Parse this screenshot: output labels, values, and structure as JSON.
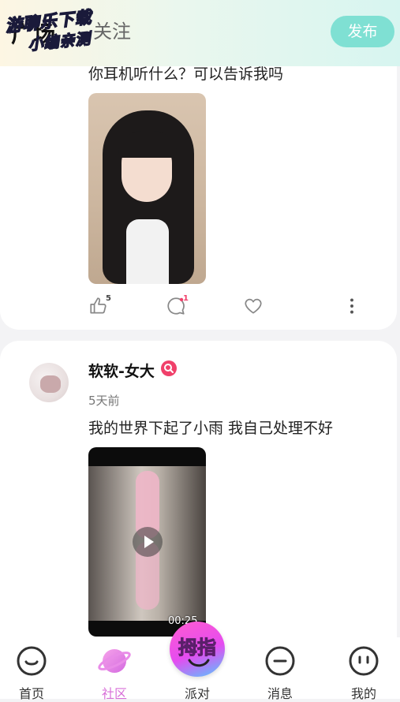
{
  "header": {
    "tabs": [
      "广场",
      "关注"
    ],
    "promo": [
      "游聊乐下载",
      "小编亲测"
    ],
    "publish_label": "发布"
  },
  "posts": [
    {
      "text": "你耳机听什么？可以告诉我吗",
      "likes": "5",
      "comments": "1"
    },
    {
      "username": "软软-女大",
      "time": "5天前",
      "text": "我的世界下起了小雨 我自己处理不好",
      "video_duration": "00:25"
    }
  ],
  "nav": {
    "items": [
      "首页",
      "社区",
      "派对",
      "消息",
      "我的"
    ],
    "active": "社区",
    "center_button": "拇指"
  },
  "colors": {
    "accent": "#d86fd8",
    "publish": "#7fe0d3",
    "verify": "#f0406a"
  }
}
